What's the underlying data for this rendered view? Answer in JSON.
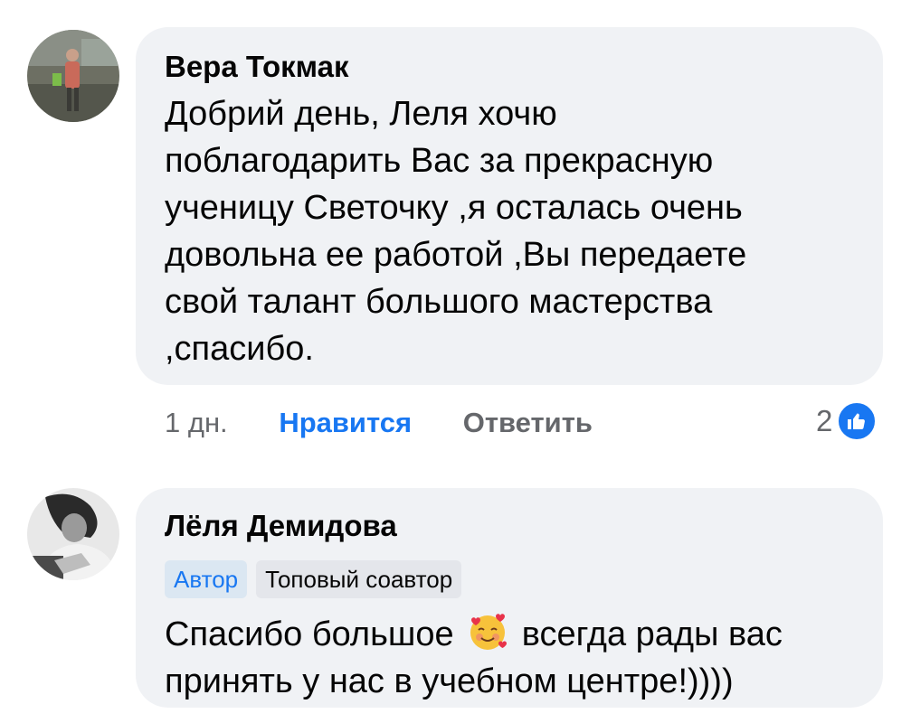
{
  "comments": [
    {
      "author": "Вера Токмак",
      "text": "Добрий день, Леля хочю поблагодарить Вас за прекрасную ученицу Светочку ,я осталась очень довольна ее работой ,Вы передаете свой талант большого мастерства ,спасибо.",
      "time": "1 дн.",
      "like_label": "Нравится",
      "reply_label": "Ответить",
      "reaction_count": "2",
      "reaction_icon": "thumbs-up-icon",
      "avatar_icon": "user-photo-avatar"
    },
    {
      "author": "Лёля Демидова",
      "badges": [
        "Автор",
        "Топовый соавтор"
      ],
      "text_before": "Спасибо большое",
      "emoji": "smiling-face-with-hearts-emoji",
      "text_after": "всегда рады вас принять у нас в учебном центре!))))",
      "avatar_icon": "user-photo-avatar"
    }
  ],
  "colors": {
    "bubble": "#f0f2f5",
    "link": "#1877f2",
    "muted": "#65676b",
    "text": "#050505"
  }
}
